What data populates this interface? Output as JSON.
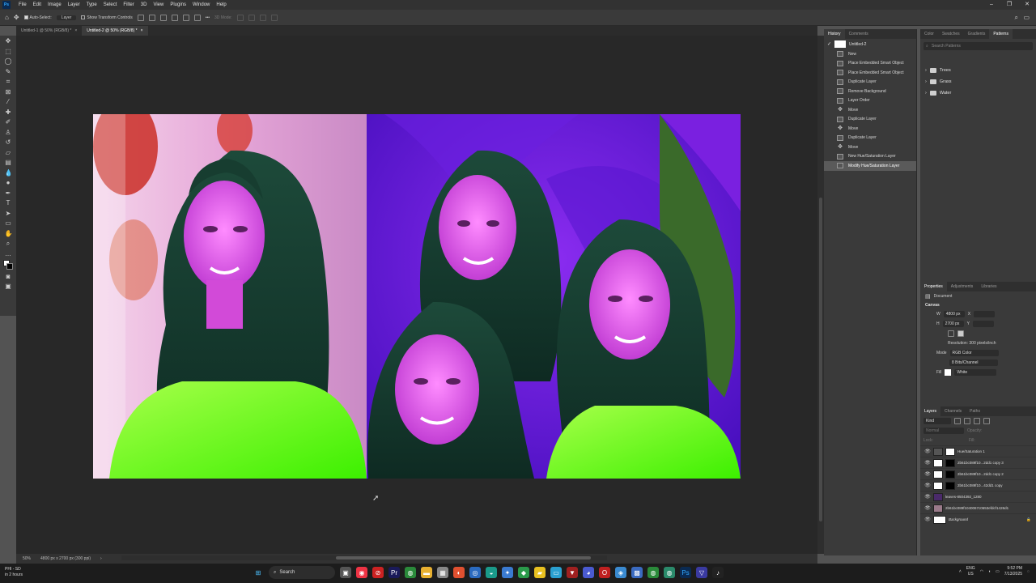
{
  "menu": {
    "items": [
      "File",
      "Edit",
      "Image",
      "Layer",
      "Type",
      "Select",
      "Filter",
      "3D",
      "View",
      "Plugins",
      "Window",
      "Help"
    ]
  },
  "options": {
    "auto_select": "Auto-Select:",
    "layer": "Layer",
    "show_transform": "Show Transform Controls",
    "mode_3d": "3D Mode:"
  },
  "tabs": [
    {
      "label": "Untitled-1 @ 50% (RGB/8) *"
    },
    {
      "label": "Untitled-2 @ 50% (RGB/8) *"
    }
  ],
  "status": {
    "zoom": "50%",
    "doc_info": "4800 px x 2700 px (300 ppi)"
  },
  "history": {
    "tabs": [
      "History",
      "Comments"
    ],
    "snapshot": "Untitled-2",
    "items": [
      "New",
      "Place Embedded Smart Object",
      "Place Embedded Smart Object",
      "Duplicate Layer",
      "Remove Background",
      "Layer Order",
      "Move",
      "Duplicate Layer",
      "Move",
      "Duplicate Layer",
      "Move",
      "New Hue/Saturation Layer",
      "Modify Hue/Saturation Layer"
    ]
  },
  "patterns": {
    "tabs": [
      "Color",
      "Swatches",
      "Gradients",
      "Patterns"
    ],
    "search_placeholder": "Search Patterns",
    "folders": [
      "Trees",
      "Grass",
      "Water"
    ]
  },
  "properties": {
    "tabs": [
      "Properties",
      "Adjustments",
      "Libraries"
    ],
    "doc_label": "Document",
    "canvas_title": "Canvas",
    "w_label": "W",
    "w_value": "4800 px",
    "x_label": "X",
    "h_label": "H",
    "h_value": "2700 px",
    "y_label": "Y",
    "resolution": "Resolution: 300 pixels/inch",
    "mode_label": "Mode",
    "mode_value": "RGB Color",
    "depth_value": "8 Bits/Channel",
    "fill_label": "Fill",
    "fill_value": "White"
  },
  "layers": {
    "tabs": [
      "Layers",
      "Channels",
      "Paths"
    ],
    "kind": "Kind",
    "blend": "Normal",
    "opacity": "Opacity:",
    "lock": "Lock:",
    "fill": "Fill:",
    "rows": [
      {
        "name": "Hue/Saturation 1"
      },
      {
        "name": "2b61bc089f10...2dd1 copy 3"
      },
      {
        "name": "2b61bc089f10...2dd1 copy 2"
      },
      {
        "name": "2b61bc089f10...42dd1 copy"
      },
      {
        "name": "leaves-8504392_1280"
      },
      {
        "name": "2b61bc089f1040067c0653efdcf1426d1"
      },
      {
        "name": "Background"
      }
    ]
  },
  "taskbar": {
    "user": "PHI - SD",
    "user_sub": "in 2 hours",
    "search": "Search",
    "lang": "ENG",
    "region": "US",
    "time": "9:52 PM",
    "date": "7/13/2025"
  }
}
